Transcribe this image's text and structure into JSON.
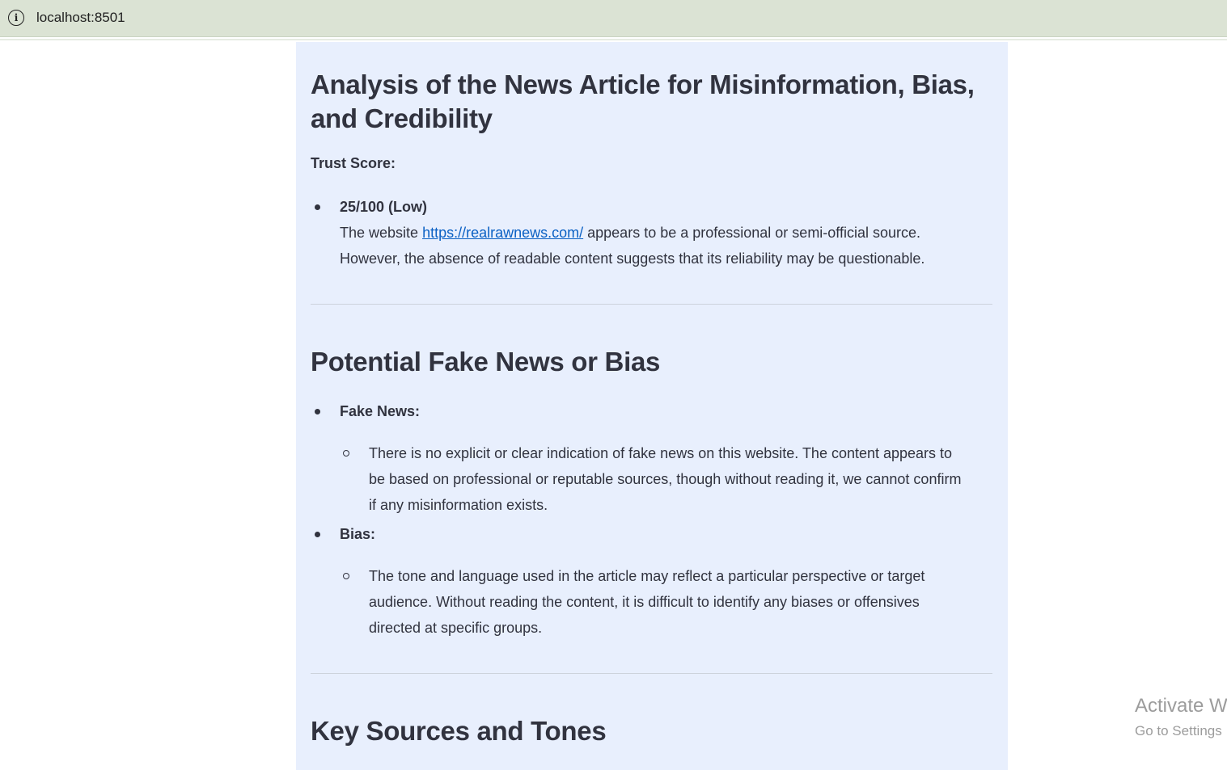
{
  "browser": {
    "url": "localhost:8501"
  },
  "article": {
    "title": "Analysis of the News Article for Misinformation, Bias, and Credibility",
    "trust_label": "Trust Score:",
    "trust_value": "25/100 (Low)",
    "trust_text_before": "The website ",
    "trust_link": "https://realrawnews.com/",
    "trust_text_after": " appears to be a professional or semi-official source.",
    "trust_text_line2": "However, the absence of readable content suggests that its reliability may be questionable.",
    "section2_title": "Potential Fake News or Bias",
    "fake_news_label": "Fake News:",
    "fake_news_line1": "There is no explicit or clear indication of fake news on this website. The content appears to",
    "fake_news_line2": "be based on professional or reputable sources, though without reading it, we cannot confirm",
    "fake_news_line3": "if any misinformation exists.",
    "bias_label": "Bias:",
    "bias_line1": "The tone and language used in the article may reflect a particular perspective or target",
    "bias_line2": "audience. Without reading the content, it is difficult to identify any biases or offensives",
    "bias_line3": "directed at specific groups.",
    "section3_title": "Key Sources and Tones"
  },
  "watermark": {
    "line1": "Activate W",
    "line2": "Go to Settings"
  }
}
